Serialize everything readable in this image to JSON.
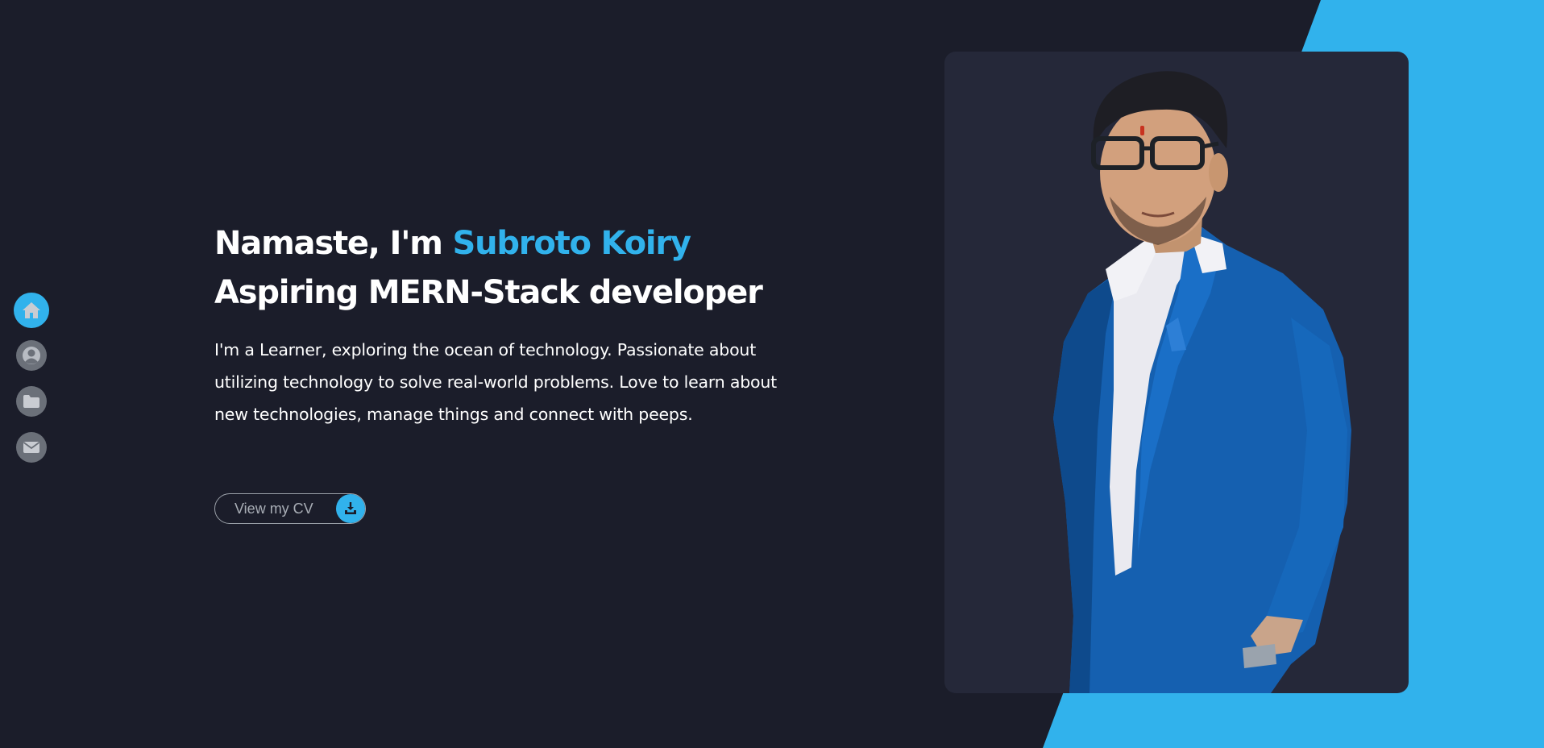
{
  "nav": {
    "items": [
      {
        "icon": "home-icon",
        "active": true
      },
      {
        "icon": "user-icon",
        "active": false
      },
      {
        "icon": "folder-icon",
        "active": false
      },
      {
        "icon": "envelope-icon",
        "active": false
      }
    ]
  },
  "hero": {
    "greeting": "Namaste, I'm ",
    "name": "Subroto Koiry",
    "role": "Aspiring MERN-Stack developer",
    "intro": "I'm a Learner, exploring the ocean of technology. Passionate about utilizing technology to solve real-world problems. Love to learn about new technologies, manage things and connect with peeps."
  },
  "cv_button": {
    "label": "View my CV",
    "icon": "download-icon"
  },
  "profile_photo": {
    "subject": "portrait-of-man-in-blue-suit"
  },
  "colors": {
    "background": "#1b1d2a",
    "accent": "#31b2ec",
    "card": "#252839",
    "nav_inactive": "#6b7079",
    "text": "#ffffff"
  }
}
